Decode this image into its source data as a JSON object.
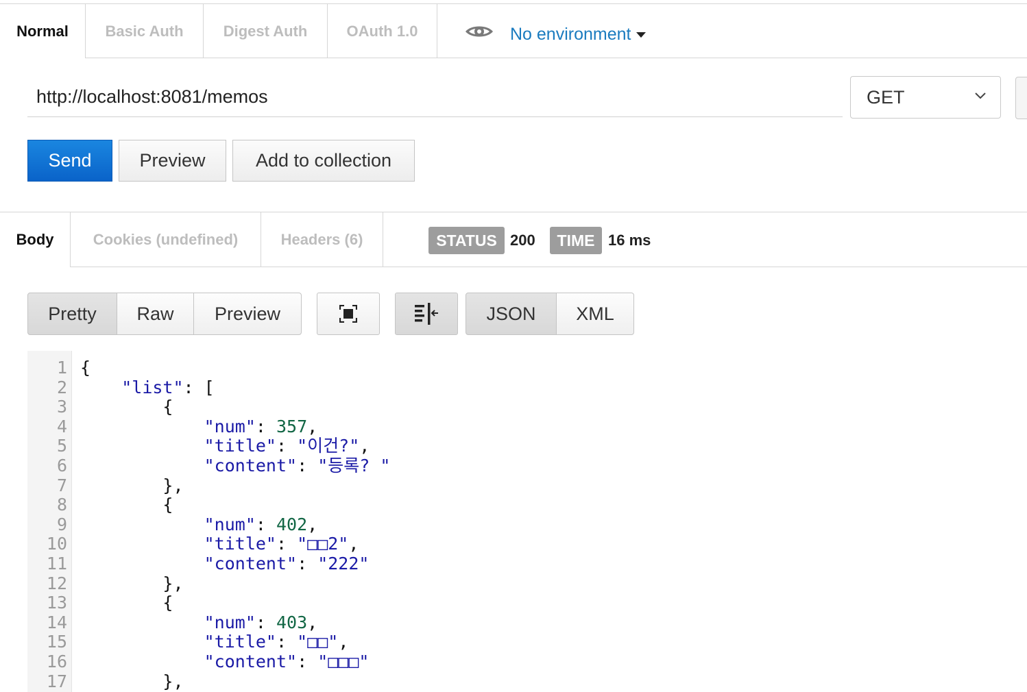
{
  "auth_tabs": [
    {
      "label": "Normal",
      "active": true
    },
    {
      "label": "Basic Auth",
      "active": false
    },
    {
      "label": "Digest Auth",
      "active": false
    },
    {
      "label": "OAuth 1.0",
      "active": false
    }
  ],
  "environment": {
    "label": "No environment",
    "icon": "eye-icon"
  },
  "request": {
    "url": "http://localhost:8081/memos",
    "method": "GET",
    "send_label": "Send",
    "preview_label": "Preview",
    "add_to_collection_label": "Add to collection"
  },
  "response_tabs": [
    {
      "label": "Body",
      "active": true
    },
    {
      "label": "Cookies (undefined)",
      "active": false
    },
    {
      "label": "Headers (6)",
      "active": false
    }
  ],
  "status": {
    "status_label": "STATUS",
    "status_value": "200",
    "time_label": "TIME",
    "time_value": "16 ms"
  },
  "view_modes": {
    "pretty": "Pretty",
    "raw": "Raw",
    "preview": "Preview",
    "json": "JSON",
    "xml": "XML",
    "fullscreen_icon": "fullscreen-icon",
    "wrap_icon": "wrap-lines-icon"
  },
  "colors": {
    "send": "#0a63c9",
    "env_link": "#1a7bbf",
    "json_key": "#1a1aa6",
    "json_number": "#116644",
    "badge": "#9d9d9d"
  },
  "code_lines": [
    {
      "n": "1",
      "indent": "",
      "parts": [
        [
          "p",
          "{"
        ]
      ]
    },
    {
      "n": "2",
      "indent": "    ",
      "parts": [
        [
          "k",
          "\"list\""
        ],
        [
          "p",
          ": ["
        ]
      ]
    },
    {
      "n": "3",
      "indent": "        ",
      "parts": [
        [
          "p",
          "{"
        ]
      ]
    },
    {
      "n": "4",
      "indent": "            ",
      "parts": [
        [
          "k",
          "\"num\""
        ],
        [
          "p",
          ": "
        ],
        [
          "n",
          "357"
        ],
        [
          "p",
          ","
        ]
      ]
    },
    {
      "n": "5",
      "indent": "            ",
      "parts": [
        [
          "k",
          "\"title\""
        ],
        [
          "p",
          ": "
        ],
        [
          "s",
          "\"이건?\""
        ],
        [
          "p",
          ","
        ]
      ]
    },
    {
      "n": "6",
      "indent": "            ",
      "parts": [
        [
          "k",
          "\"content\""
        ],
        [
          "p",
          ": "
        ],
        [
          "s",
          "\"등록? \""
        ]
      ]
    },
    {
      "n": "7",
      "indent": "        ",
      "parts": [
        [
          "p",
          "},"
        ]
      ]
    },
    {
      "n": "8",
      "indent": "        ",
      "parts": [
        [
          "p",
          "{"
        ]
      ]
    },
    {
      "n": "9",
      "indent": "            ",
      "parts": [
        [
          "k",
          "\"num\""
        ],
        [
          "p",
          ": "
        ],
        [
          "n",
          "402"
        ],
        [
          "p",
          ","
        ]
      ]
    },
    {
      "n": "10",
      "indent": "            ",
      "parts": [
        [
          "k",
          "\"title\""
        ],
        [
          "p",
          ": "
        ],
        [
          "s",
          "\"□□2\""
        ],
        [
          "p",
          ","
        ]
      ]
    },
    {
      "n": "11",
      "indent": "            ",
      "parts": [
        [
          "k",
          "\"content\""
        ],
        [
          "p",
          ": "
        ],
        [
          "s",
          "\"222\""
        ]
      ]
    },
    {
      "n": "12",
      "indent": "        ",
      "parts": [
        [
          "p",
          "},"
        ]
      ]
    },
    {
      "n": "13",
      "indent": "        ",
      "parts": [
        [
          "p",
          "{"
        ]
      ]
    },
    {
      "n": "14",
      "indent": "            ",
      "parts": [
        [
          "k",
          "\"num\""
        ],
        [
          "p",
          ": "
        ],
        [
          "n",
          "403"
        ],
        [
          "p",
          ","
        ]
      ]
    },
    {
      "n": "15",
      "indent": "            ",
      "parts": [
        [
          "k",
          "\"title\""
        ],
        [
          "p",
          ": "
        ],
        [
          "s",
          "\"□□\""
        ],
        [
          "p",
          ","
        ]
      ]
    },
    {
      "n": "16",
      "indent": "            ",
      "parts": [
        [
          "k",
          "\"content\""
        ],
        [
          "p",
          ": "
        ],
        [
          "s",
          "\"□□□\""
        ]
      ]
    },
    {
      "n": "17",
      "indent": "        ",
      "parts": [
        [
          "p",
          "},"
        ]
      ]
    }
  ]
}
